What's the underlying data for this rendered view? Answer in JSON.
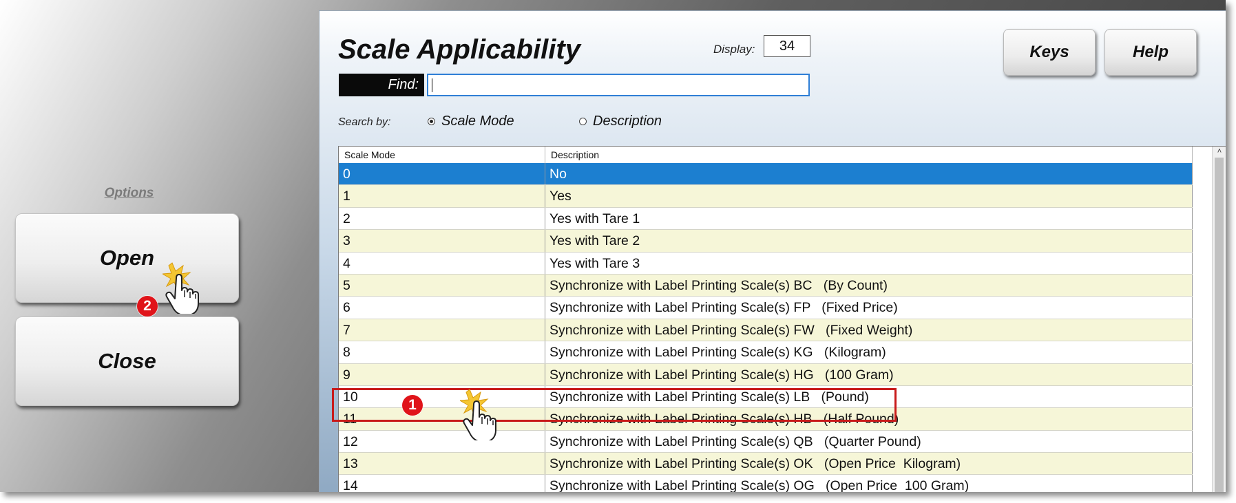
{
  "options": {
    "label": "Options",
    "open_label": "Open",
    "close_label": "Close"
  },
  "window": {
    "title": "Scale Applicability",
    "display_label": "Display:",
    "display_value": "34",
    "find_label": "Find:",
    "find_value": "",
    "search_by_label": "Search by:",
    "radio_scale_mode": "Scale Mode",
    "radio_description": "Description",
    "selected_search": "Scale Mode",
    "keys_label": "Keys",
    "help_label": "Help"
  },
  "grid": {
    "columns": [
      "Scale Mode",
      "Description"
    ],
    "selected_row": 0,
    "highlighted_row": 10,
    "rows": [
      {
        "mode": "0",
        "desc": "No"
      },
      {
        "mode": "1",
        "desc": "Yes"
      },
      {
        "mode": "2",
        "desc": "Yes with Tare 1"
      },
      {
        "mode": "3",
        "desc": "Yes with Tare 2"
      },
      {
        "mode": "4",
        "desc": "Yes with Tare 3"
      },
      {
        "mode": "5",
        "desc": "Synchronize with Label Printing Scale(s) BC   (By Count)"
      },
      {
        "mode": "6",
        "desc": "Synchronize with Label Printing Scale(s) FP   (Fixed Price)"
      },
      {
        "mode": "7",
        "desc": "Synchronize with Label Printing Scale(s) FW   (Fixed Weight)"
      },
      {
        "mode": "8",
        "desc": "Synchronize with Label Printing Scale(s) KG   (Kilogram)"
      },
      {
        "mode": "9",
        "desc": "Synchronize with Label Printing Scale(s) HG   (100 Gram)"
      },
      {
        "mode": "10",
        "desc": "Synchronize with Label Printing Scale(s) LB   (Pound)"
      },
      {
        "mode": "11",
        "desc": "Synchronize with Label Printing Scale(s) HB   (Half Pound)"
      },
      {
        "mode": "12",
        "desc": "Synchronize with Label Printing Scale(s) QB   (Quarter Pound)"
      },
      {
        "mode": "13",
        "desc": "Synchronize with Label Printing Scale(s) OK   (Open Price  Kilogram)"
      },
      {
        "mode": "14",
        "desc": "Synchronize with Label Printing Scale(s) OG   (Open Price  100 Gram)"
      }
    ]
  },
  "annotations": {
    "step_1": "1",
    "step_2": "2"
  },
  "colors": {
    "selected_row": "#1c7fd0",
    "alt_row": "#f6f6d8",
    "highlight": "#c81a1a",
    "badge": "#e0141a"
  }
}
